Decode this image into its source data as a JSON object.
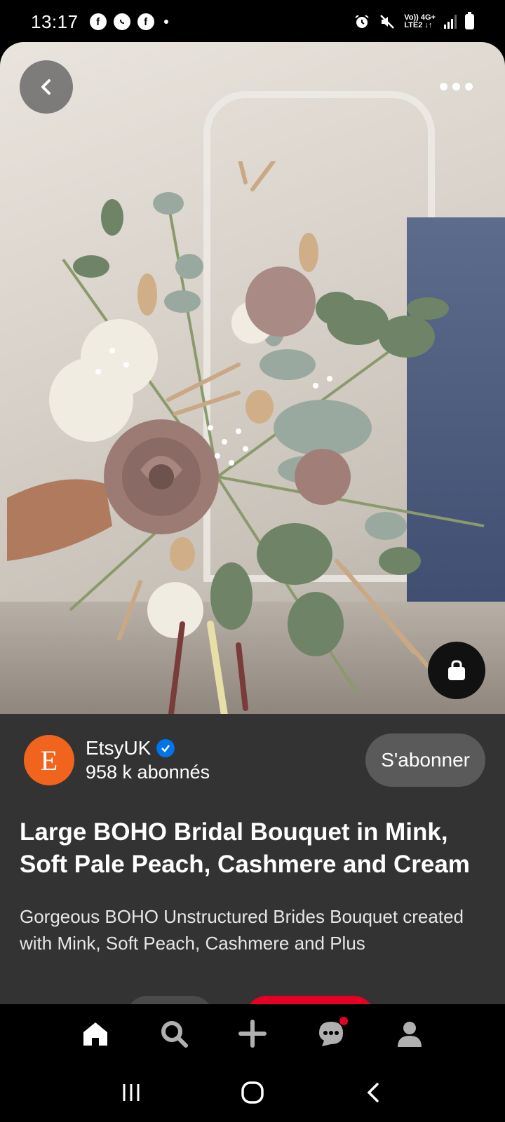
{
  "status_bar": {
    "time": "13:17",
    "net_top": "Vo)) 4G+",
    "net_bottom": "LTE2 ↓↑"
  },
  "pin": {
    "creator_initial": "E",
    "creator_name": "EtsyUK",
    "followers": "958 k abonnés",
    "follow_label": "S'abonner",
    "title": "Large BOHO Bridal Bouquet in Mink, Soft Pale Peach, Cashmere and Cream",
    "description": "Gorgeous BOHO Unstructured Brides Bouquet created with Mink, Soft Peach, Cashmere and Plus"
  },
  "colors": {
    "accent": "#e60023",
    "avatar_bg": "#f1641e",
    "verified": "#0074e8",
    "panel_bg": "#333333"
  },
  "icons": {
    "back": "chevron-left-icon",
    "more": "more-horizontal-icon",
    "shop": "shopping-bag-icon",
    "nav": [
      "home-icon",
      "search-icon",
      "plus-icon",
      "chat-icon",
      "profile-icon"
    ],
    "system": [
      "recents-icon",
      "home-circle-icon",
      "back-chevron-icon"
    ]
  }
}
